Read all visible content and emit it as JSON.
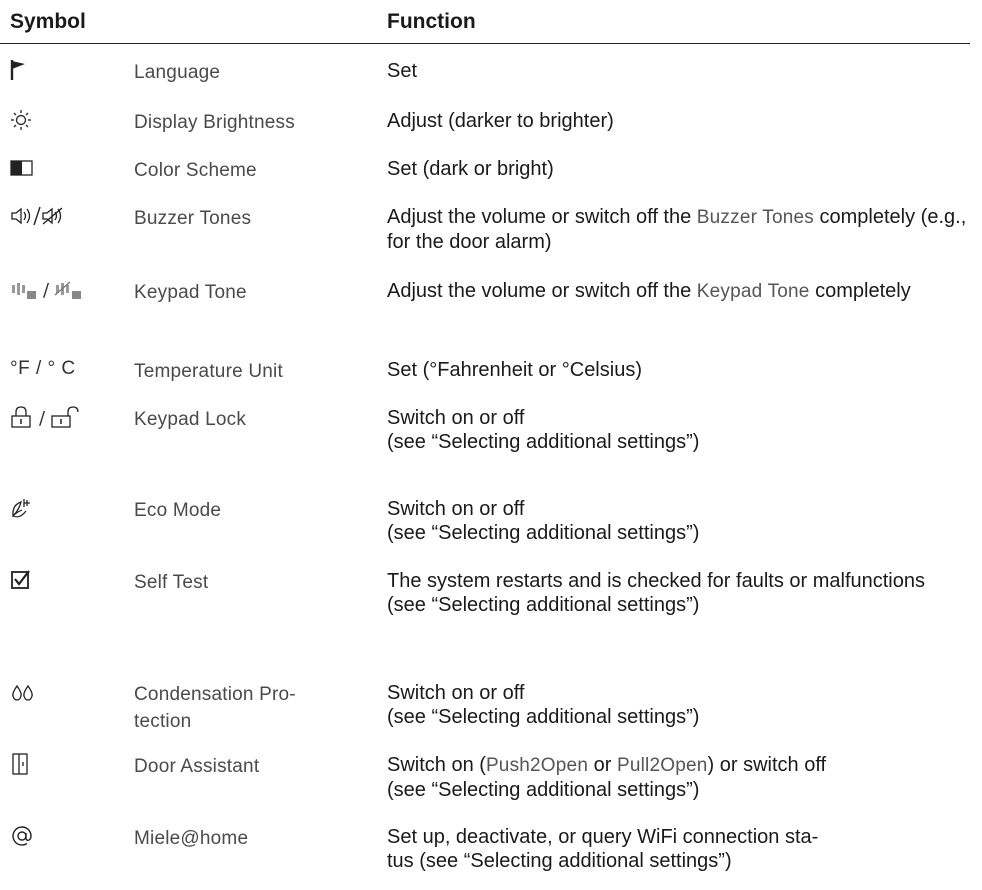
{
  "header": {
    "symbol": "Symbol",
    "function": "Function"
  },
  "rows": [
    {
      "setting": "Language",
      "func": "Set"
    },
    {
      "setting": "Display Brightness",
      "func": "Adjust (darker to brighter)"
    },
    {
      "setting": "Color Scheme",
      "func": "Set (dark or bright)"
    },
    {
      "setting": "Buzzer Tones",
      "func_a": "Adjust the volume or switch off the ",
      "func_b": "Buzzer Tones",
      "func_c": " completely (e.g., for the door alarm)"
    },
    {
      "setting": "Keypad Tone",
      "func_a": "Adjust the volume or switch off the ",
      "func_b": "Keypad Tone",
      "func_c": " completely"
    },
    {
      "symbol": "°F / ° C",
      "setting": "Temperature Unit",
      "func": "Set (°Fahrenheit or °Celsius)"
    },
    {
      "setting": "Keypad Lock",
      "func_1": "Switch on or off",
      "func_2": "(see “Selecting additional settings”)"
    },
    {
      "setting": "Eco Mode",
      "func_1": "Switch on or off",
      "func_2": "(see “Selecting additional settings”)"
    },
    {
      "setting": "Self Test",
      "func_1": "The system restarts and is checked for faults or malfunctions",
      "func_2": "(see “Selecting additional settings”)"
    },
    {
      "setting": "Condensation Pro-tection",
      "func_1": "Switch on or off",
      "func_2": "(see “Selecting additional settings”)"
    },
    {
      "setting": "Door Assistant",
      "func_a": "Switch on (",
      "func_b": "Push2Open",
      "func_c": " or ",
      "func_d": "Pull2Open",
      "func_e": ") or switch off",
      "func_2": "(see “Selecting additional settings”)"
    },
    {
      "setting": "Miele@home",
      "func": "Set up, deactivate, or query WiFi connection sta-tus (see “Selecting additional settings”)"
    }
  ]
}
